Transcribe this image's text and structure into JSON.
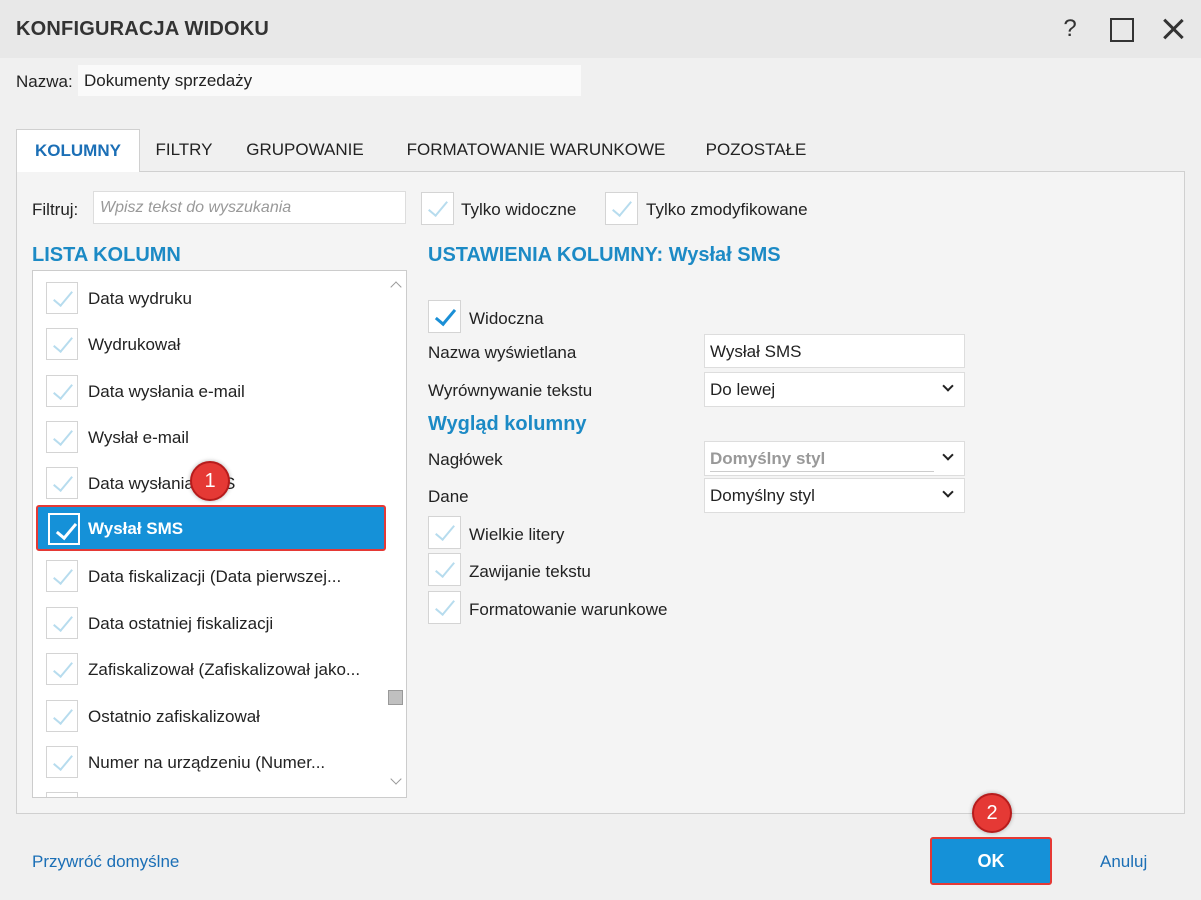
{
  "window": {
    "title": "KONFIGURACJA WIDOKU",
    "help_label": "?"
  },
  "name": {
    "label": "Nazwa:",
    "value": "Dokumenty sprzedaży"
  },
  "tabs": [
    {
      "label": "KOLUMNY",
      "active": true
    },
    {
      "label": "FILTRY",
      "active": false
    },
    {
      "label": "GRUPOWANIE",
      "active": false
    },
    {
      "label": "FORMATOWANIE WARUNKOWE",
      "active": false
    },
    {
      "label": "POZOSTAŁE",
      "active": false
    }
  ],
  "filter": {
    "label": "Filtruj:",
    "placeholder": "Wpisz tekst do wyszukania",
    "only_visible_label": "Tylko widoczne",
    "only_modified_label": "Tylko zmodyfikowane"
  },
  "column_list": {
    "heading": "LISTA KOLUMN",
    "items": [
      {
        "label": "Data wydruku",
        "checked": false
      },
      {
        "label": "Wydrukował",
        "checked": false
      },
      {
        "label": "Data wysłania e-mail",
        "checked": false
      },
      {
        "label": "Wysłał e-mail",
        "checked": false
      },
      {
        "label": "Data wysłania SMS",
        "checked": false
      },
      {
        "label": "Wysłał SMS",
        "checked": true,
        "selected": true
      },
      {
        "label": "Data fiskalizacji (Data pierwszej...",
        "checked": false
      },
      {
        "label": "Data ostatniej fiskalizacji",
        "checked": false
      },
      {
        "label": "Zafiskalizował (Zafiskalizował jako...",
        "checked": false
      },
      {
        "label": "Ostatnio zafiskalizował",
        "checked": false
      },
      {
        "label": "Numer na urządzeniu (Numer...",
        "checked": false
      }
    ]
  },
  "settings": {
    "heading": "USTAWIENIA KOLUMNY: Wysłał SMS",
    "visible_label": "Widoczna",
    "display_name_label": "Nazwa wyświetlana",
    "display_name_value": "Wysłał SMS",
    "alignment_label": "Wyrównywanie tekstu",
    "alignment_value": "Do lewej",
    "appearance_heading": "Wygląd kolumny",
    "header_label": "Nagłówek",
    "header_value": "Domyślny styl",
    "data_label": "Dane",
    "data_value": "Domyślny styl",
    "uppercase_label": "Wielkie litery",
    "wrap_label": "Zawijanie tekstu",
    "conditional_label": "Formatowanie warunkowe"
  },
  "badges": {
    "first": "1",
    "second": "2"
  },
  "footer": {
    "restore_label": "Przywróć domyślne",
    "ok_label": "OK",
    "cancel_label": "Anuluj"
  },
  "colors": {
    "accent": "#1591d8",
    "heading": "#1c8ac5",
    "highlight_border": "#e53935"
  }
}
